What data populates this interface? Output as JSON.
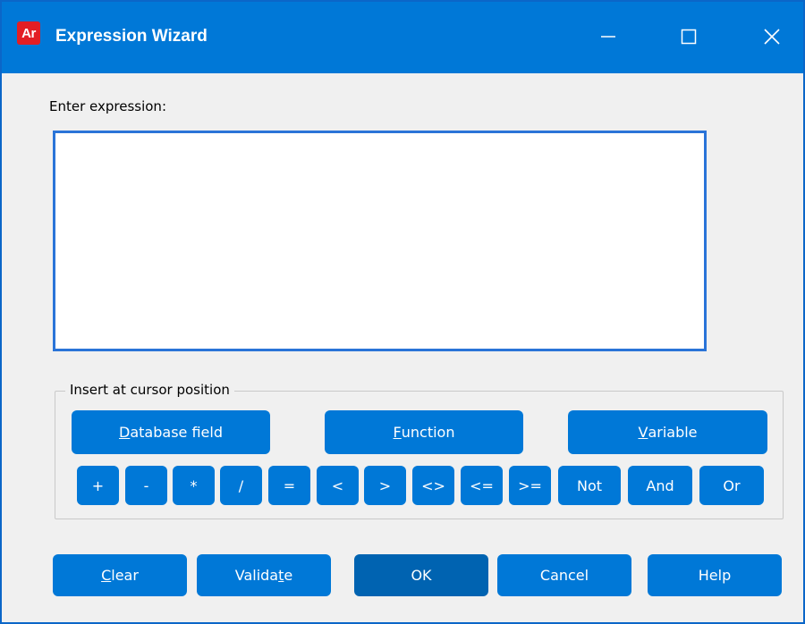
{
  "window": {
    "title": "Expression Wizard",
    "app_icon_text": "Ar"
  },
  "expression": {
    "label": "Enter expression:",
    "value": ""
  },
  "insert_group": {
    "legend": "Insert at cursor position",
    "database_field": {
      "pre": "",
      "acc": "D",
      "post": "atabase field"
    },
    "function": {
      "pre": "",
      "acc": "F",
      "post": "unction"
    },
    "variable": {
      "pre": "",
      "acc": "V",
      "post": "ariable"
    },
    "operators": [
      "+",
      "-",
      "*",
      "/",
      "=",
      "<",
      ">",
      "<>",
      "<=",
      ">=",
      "Not",
      "And",
      "Or"
    ]
  },
  "footer": {
    "clear": {
      "pre": "",
      "acc": "C",
      "post": "lear"
    },
    "validate": {
      "pre": "Valida",
      "acc": "t",
      "post": "e"
    },
    "ok": "OK",
    "cancel": "Cancel",
    "help": "Help"
  },
  "colors": {
    "titlebar": "#0078d7",
    "button": "#0078d7",
    "button_default": "#0063b1",
    "input_focus_border": "#2a74d8",
    "app_icon": "#e31e24"
  }
}
